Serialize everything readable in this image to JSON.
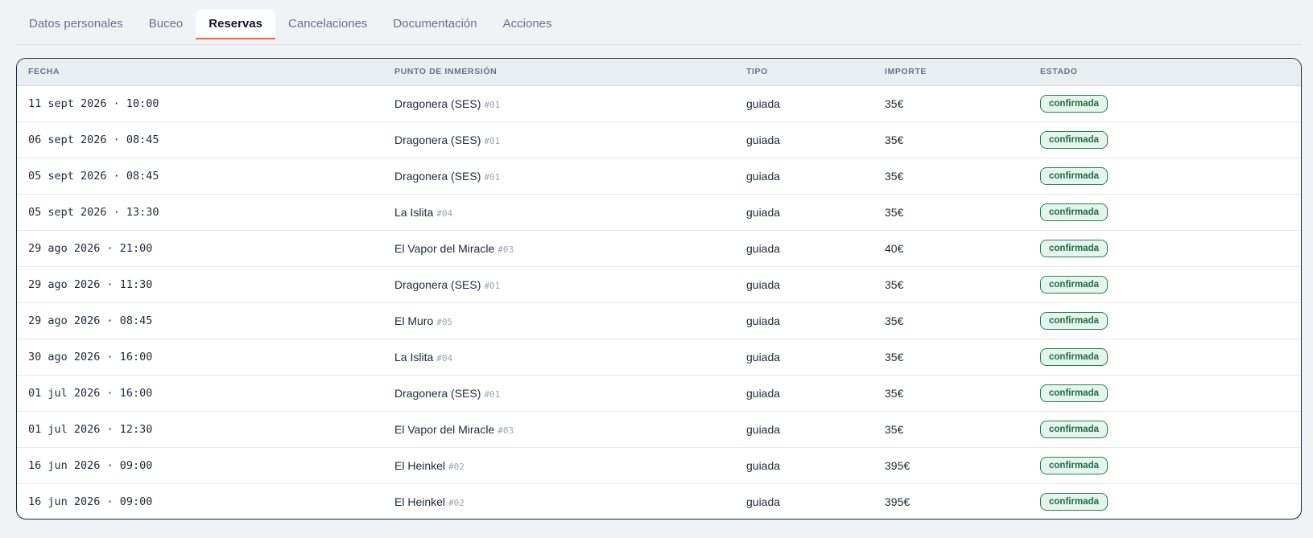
{
  "tabs": [
    {
      "label": "Datos personales",
      "active": false
    },
    {
      "label": "Buceo",
      "active": false
    },
    {
      "label": "Reservas",
      "active": true
    },
    {
      "label": "Cancelaciones",
      "active": false
    },
    {
      "label": "Documentación",
      "active": false
    },
    {
      "label": "Acciones",
      "active": false
    }
  ],
  "colors": {
    "active_tab_underline": "#f26443",
    "badge_text": "#1e6b47",
    "badge_background": "#e5f5ec",
    "badge_border": "#2a7d56"
  },
  "table": {
    "headers": {
      "fecha": "FECHA",
      "punto": "PUNTO DE INMERSIÓN",
      "tipo": "TIPO",
      "importe": "IMPORTE",
      "estado": "ESTADO"
    },
    "rows": [
      {
        "fecha": "11 sept 2026 · 10:00",
        "punto": "Dragonera (SES)",
        "code": "#01",
        "tipo": "guiada",
        "importe": "35€",
        "estado": "confirmada"
      },
      {
        "fecha": "06 sept 2026 · 08:45",
        "punto": "Dragonera (SES)",
        "code": "#01",
        "tipo": "guiada",
        "importe": "35€",
        "estado": "confirmada"
      },
      {
        "fecha": "05 sept 2026 · 08:45",
        "punto": "Dragonera (SES)",
        "code": "#01",
        "tipo": "guiada",
        "importe": "35€",
        "estado": "confirmada"
      },
      {
        "fecha": "05 sept 2026 · 13:30",
        "punto": "La Islita",
        "code": "#04",
        "tipo": "guiada",
        "importe": "35€",
        "estado": "confirmada"
      },
      {
        "fecha": "29 ago 2026 · 21:00",
        "punto": "El Vapor del Miracle",
        "code": "#03",
        "tipo": "guiada",
        "importe": "40€",
        "estado": "confirmada"
      },
      {
        "fecha": "29 ago 2026 · 11:30",
        "punto": "Dragonera (SES)",
        "code": "#01",
        "tipo": "guiada",
        "importe": "35€",
        "estado": "confirmada"
      },
      {
        "fecha": "29 ago 2026 · 08:45",
        "punto": "El Muro",
        "code": "#05",
        "tipo": "guiada",
        "importe": "35€",
        "estado": "confirmada"
      },
      {
        "fecha": "30 ago 2026 · 16:00",
        "punto": "La Islita",
        "code": "#04",
        "tipo": "guiada",
        "importe": "35€",
        "estado": "confirmada"
      },
      {
        "fecha": "01 jul 2026 · 16:00",
        "punto": "Dragonera (SES)",
        "code": "#01",
        "tipo": "guiada",
        "importe": "35€",
        "estado": "confirmada"
      },
      {
        "fecha": "01 jul 2026 · 12:30",
        "punto": "El Vapor del Miracle",
        "code": "#03",
        "tipo": "guiada",
        "importe": "35€",
        "estado": "confirmada"
      },
      {
        "fecha": "16 jun 2026 · 09:00",
        "punto": "El Heinkel",
        "code": "#02",
        "tipo": "guiada",
        "importe": "395€",
        "estado": "confirmada"
      },
      {
        "fecha": "16 jun 2026 · 09:00",
        "punto": "El Heinkel",
        "code": "#02",
        "tipo": "guiada",
        "importe": "395€",
        "estado": "confirmada"
      }
    ]
  }
}
